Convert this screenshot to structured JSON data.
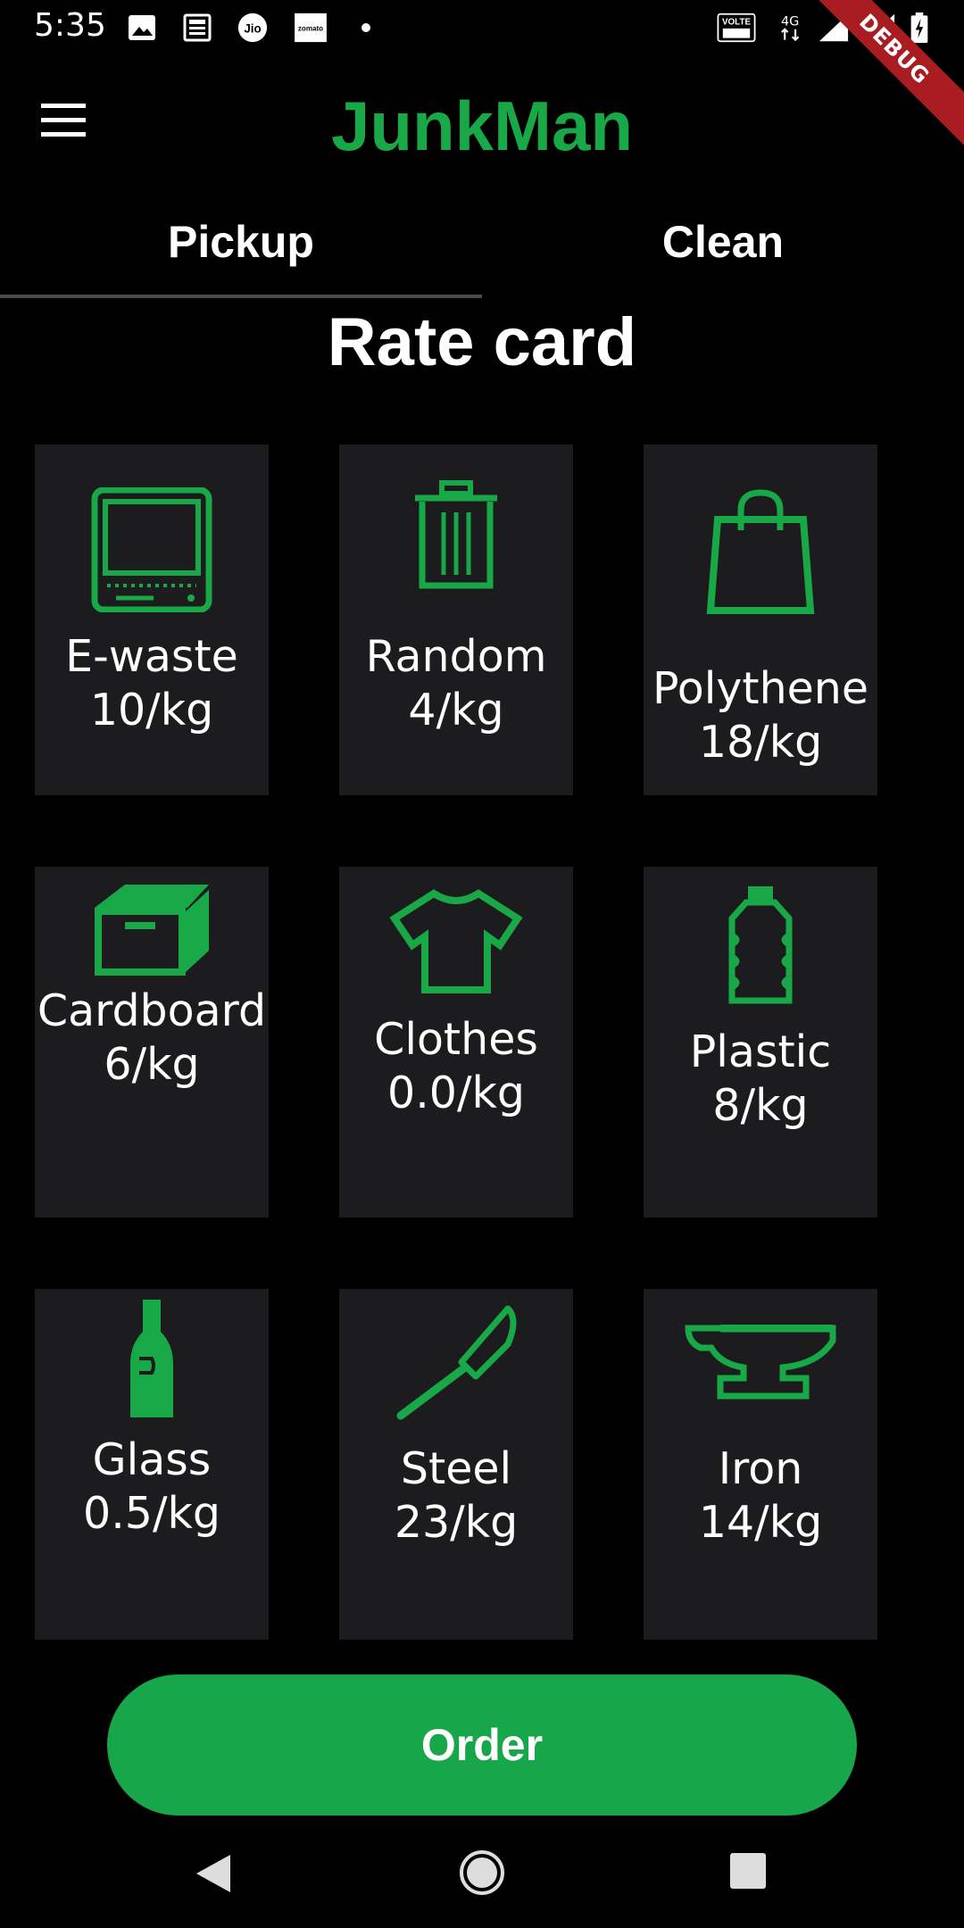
{
  "status_bar": {
    "time": "5:35",
    "icons": [
      "image-icon",
      "news-icon",
      "jio-icon",
      "zomato-icon",
      "dot-icon",
      "volte-icon",
      "4g-icon",
      "signal-icon",
      "signal-icon",
      "battery-charging-icon"
    ],
    "jio_text": "Jio",
    "zomato_text": "zomato",
    "volte_text": "VOLTE",
    "network_text": "4G",
    "debug_banner": "DEBUG"
  },
  "app_bar": {
    "title": "JunkMan",
    "menu_icon": "hamburger-menu-icon"
  },
  "tabs": [
    {
      "label": "Pickup",
      "selected": true
    },
    {
      "label": "Clean",
      "selected": false
    }
  ],
  "section_title": "Rate card",
  "rate_cards": [
    {
      "name": "E-waste",
      "rate": "10/kg",
      "icon": "laptop-icon"
    },
    {
      "name": "Random",
      "rate": "4/kg",
      "icon": "trash-bin-icon"
    },
    {
      "name": "Polythene",
      "rate": "18/kg",
      "icon": "shopping-bag-icon"
    },
    {
      "name": "Cardboard",
      "rate": "6/kg",
      "icon": "cardboard-box-icon"
    },
    {
      "name": "Clothes",
      "rate": "0.0/kg",
      "icon": "tshirt-icon"
    },
    {
      "name": "Plastic",
      "rate": "8/kg",
      "icon": "plastic-bottle-icon"
    },
    {
      "name": "Glass",
      "rate": "0.5/kg",
      "icon": "glass-bottle-icon"
    },
    {
      "name": "Steel",
      "rate": "23/kg",
      "icon": "knife-icon"
    },
    {
      "name": "Iron",
      "rate": "14/kg",
      "icon": "anvil-icon"
    }
  ],
  "order_button": {
    "label": "Order"
  },
  "nav_bar": [
    "back-icon",
    "home-icon",
    "recents-icon"
  ],
  "colors": {
    "accent": "#19a847",
    "background": "#000000",
    "card": "#1c1c1e",
    "button": "#17a74a",
    "debug_ribbon": "#a81c22"
  }
}
